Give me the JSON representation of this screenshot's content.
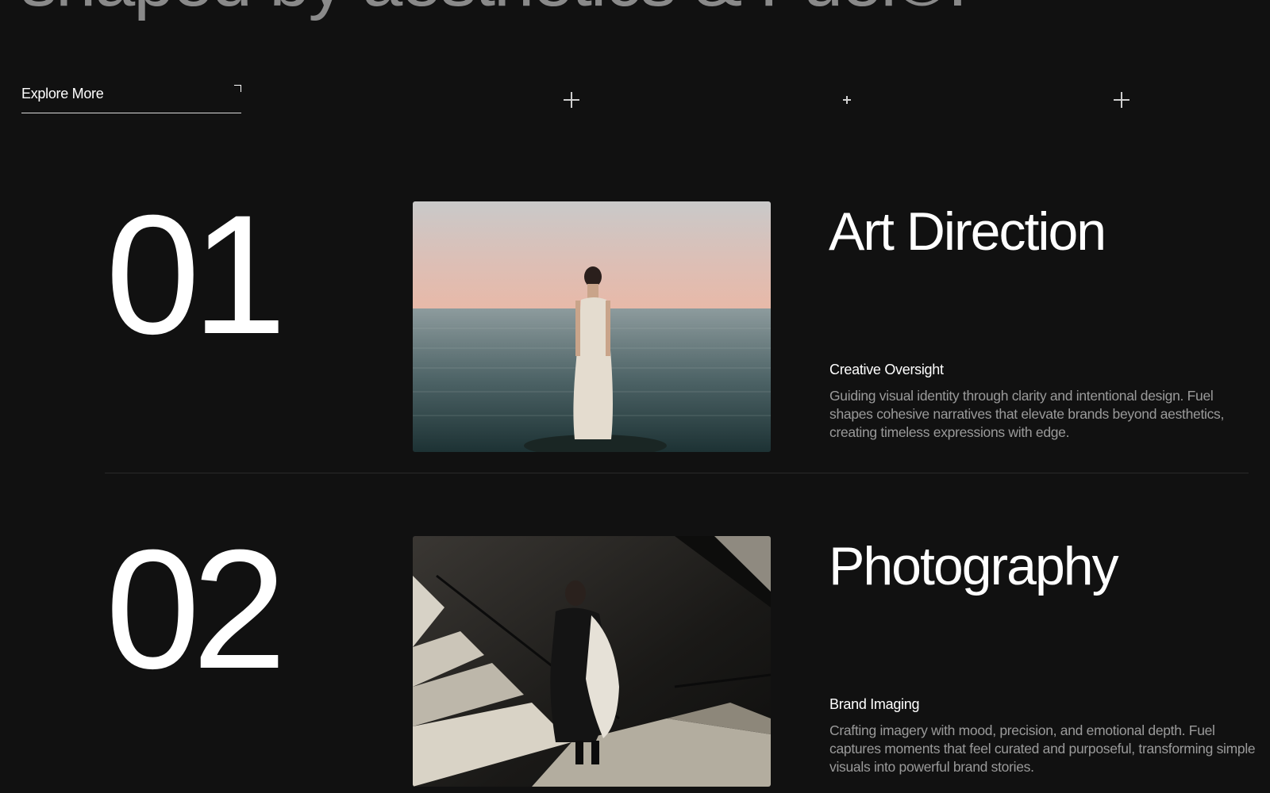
{
  "hero": {
    "headline": "shaped by aesthetics & Fuel®."
  },
  "explore": {
    "label": "Explore More",
    "icon": "arrow-up-right-icon"
  },
  "markers": [
    "plus-icon",
    "plus-icon",
    "plus-icon"
  ],
  "services": [
    {
      "number": "01",
      "title": "Art Direction",
      "subtitle": "Creative Oversight",
      "description": "Guiding visual identity through clarity and intentional design. Fuel shapes cohesive narratives that elevate brands beyond aesthetics, creating timeless expressions with edge.",
      "image": "woman-in-silk-dress-standing-in-sea-at-dusk"
    },
    {
      "number": "02",
      "title": "Photography",
      "subtitle": "Brand Imaging",
      "description": "Crafting imagery with mood, precision, and emotional depth. Fuel captures moments that feel curated and purposeful, transforming simple visuals into powerful brand stories.",
      "image": "woman-in-black-and-white-walking-down-stairs"
    }
  ],
  "colors": {
    "background": "#111111",
    "text": "#ffffff",
    "muted": "#9a9a9a",
    "headline": "#8a8a8a"
  }
}
